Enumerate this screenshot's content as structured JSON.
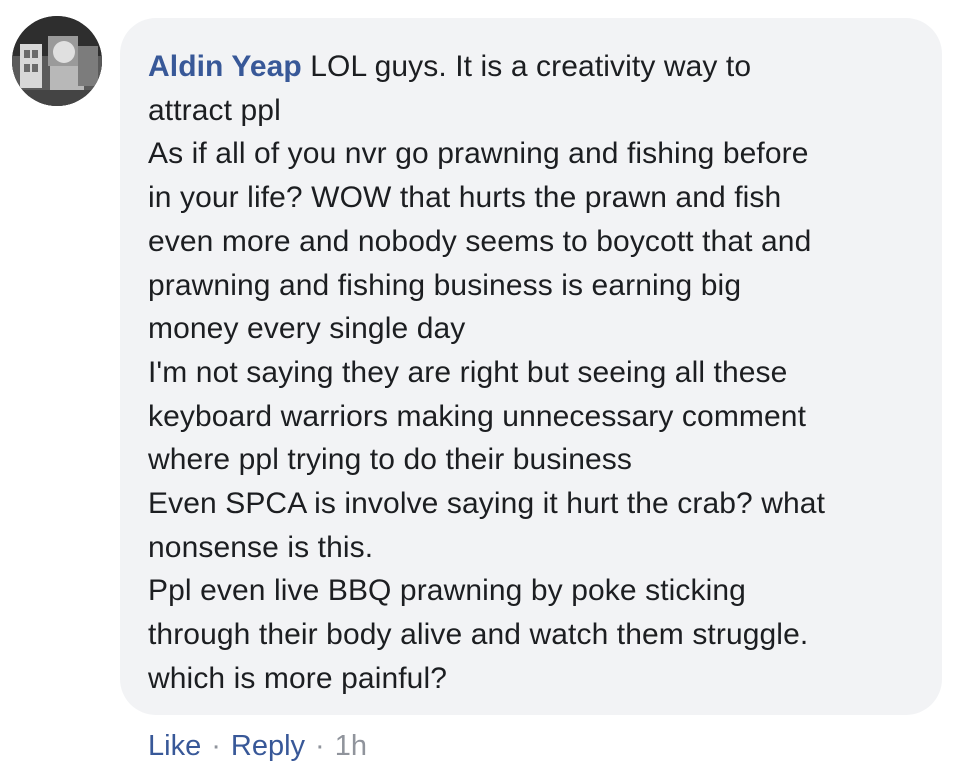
{
  "comment": {
    "author": "Aldin Yeap",
    "lines": [
      "LOL guys. It is a creativity way to",
      "attract ppl",
      "As if all of you nvr go prawning and fishing before",
      "in your life? WOW that hurts the prawn and fish",
      "even more and nobody seems to boycott that and",
      "prawning and fishing business is earning big",
      "money every single day",
      "I'm not saying they are right but seeing all these",
      "keyboard warriors making unnecessary comment",
      "where ppl trying to do their business",
      "Even SPCA is involve saying it hurt the crab? what",
      "nonsense is this.",
      "Ppl even live BBQ prawning by poke sticking",
      "through their body alive and watch them struggle.",
      "which is more painful?"
    ]
  },
  "actions": {
    "like_label": "Like",
    "separator": "·",
    "reply_label": "Reply",
    "timestamp": "1h"
  },
  "colors": {
    "author_link": "#385898",
    "bubble_bg": "#f2f3f5",
    "meta_text": "#90949c"
  }
}
